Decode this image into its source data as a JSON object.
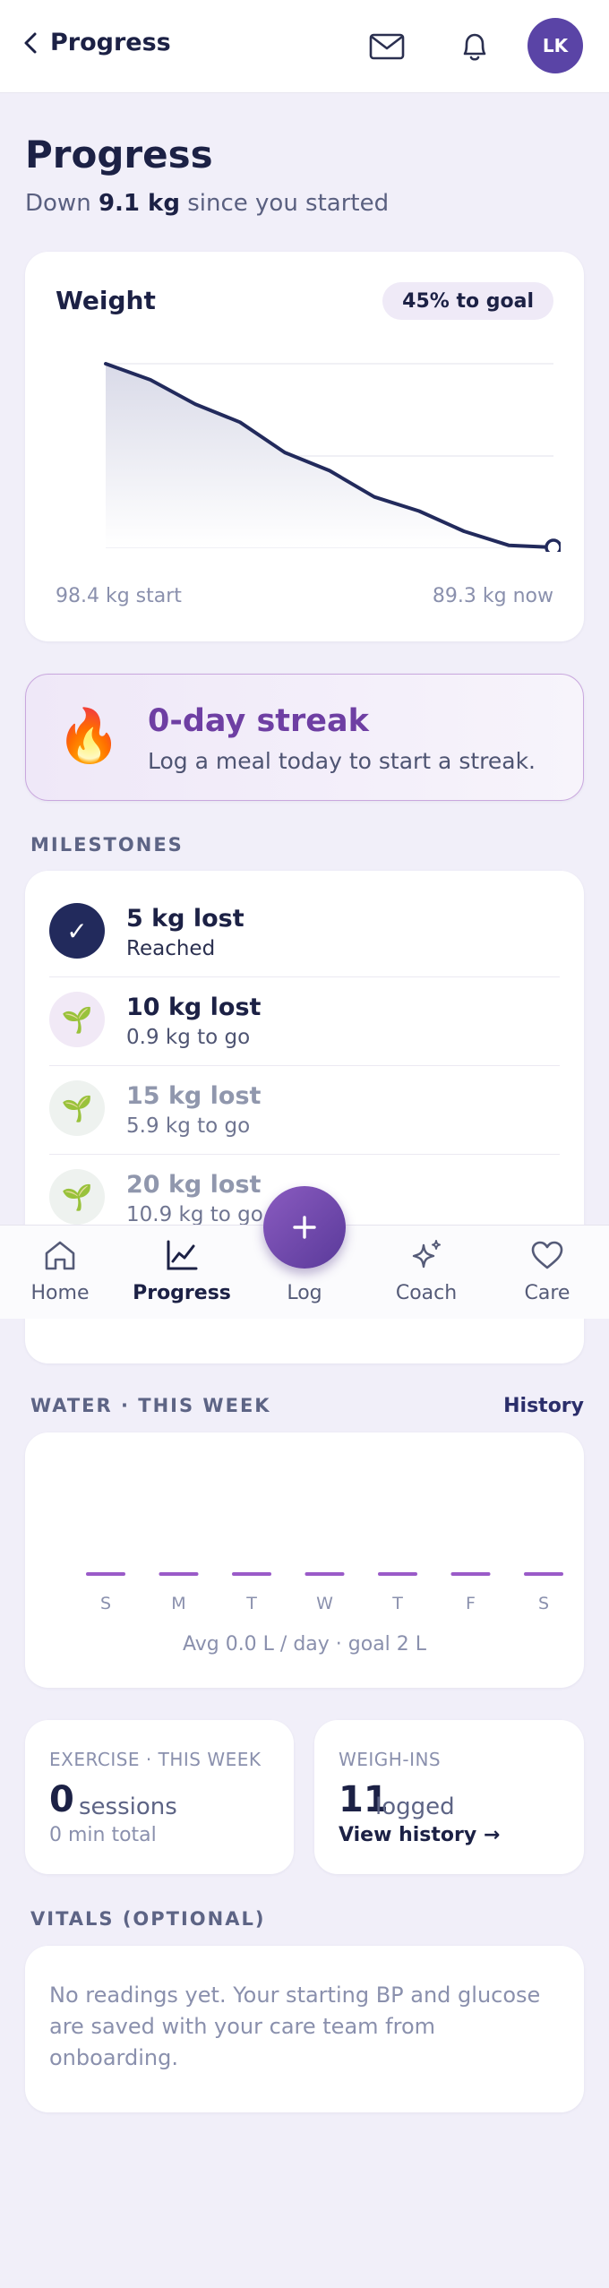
{
  "header": {
    "back_label": "Progress",
    "avatar_initials": "LK"
  },
  "page": {
    "title": "Progress",
    "subtitle_prefix": "Down ",
    "subtitle_value": "9.1 kg",
    "subtitle_suffix": " since you started"
  },
  "weight": {
    "title": "Weight",
    "goal_badge": "45% to goal",
    "start_label": "98.4 kg start",
    "now_label": "89.3 kg now"
  },
  "chart_data": [
    {
      "type": "area",
      "title": "Weight",
      "xlabel": "",
      "ylabel": "",
      "x": [
        0,
        1,
        2,
        3,
        4,
        5,
        6,
        7,
        8,
        9,
        10
      ],
      "y": [
        98.4,
        97.6,
        96.4,
        95.5,
        94.0,
        93.1,
        91.8,
        91.1,
        90.1,
        89.4,
        89.3
      ],
      "grid": true,
      "line_color": "#222a5c"
    },
    {
      "type": "bar",
      "title": "WATER · THIS WEEK",
      "categories": [
        "S",
        "M",
        "T",
        "W",
        "T",
        "F",
        "S"
      ],
      "values": [
        0,
        0,
        0,
        0,
        0,
        0,
        0
      ],
      "bar_color": "#9a5bc8"
    }
  ],
  "streak": {
    "icon": "fire-icon",
    "title": "0-day streak",
    "subtitle": "Log a meal today to start a streak."
  },
  "milestones": {
    "label": "MILESTONES",
    "items": [
      {
        "name": "5 kg lost",
        "status": "Reached",
        "icon": "check-icon"
      },
      {
        "name": "10 kg lost",
        "status": "0.9 kg to go",
        "icon": "seedling-icon"
      },
      {
        "name": "15 kg lost",
        "status": "5.9 kg to go",
        "icon": "seedling-icon"
      },
      {
        "name": "20 kg lost",
        "status": "10.9 kg to go",
        "icon": "seedling-icon"
      }
    ]
  },
  "nav": {
    "items": [
      {
        "label": "Home",
        "icon": "home-icon"
      },
      {
        "label": "Progress",
        "icon": "chart-icon"
      },
      {
        "label": "Log",
        "icon": "plus-icon"
      },
      {
        "label": "Coach",
        "icon": "sparkle-icon"
      },
      {
        "label": "Care",
        "icon": "heart-icon"
      }
    ]
  },
  "water": {
    "label": "WATER · THIS WEEK",
    "history_link": "History",
    "avg_text": "Avg 0.0 L / day · goal 2 L"
  },
  "exercise": {
    "label": "EXERCISE · THIS WEEK",
    "count": "0",
    "unit": "sessions",
    "sub": "0 min total"
  },
  "weighins": {
    "label": "WEIGH-INS",
    "count": "11",
    "unit": "logged",
    "link": "View history →"
  },
  "vitals": {
    "label": "VITALS (OPTIONAL)",
    "text": "No readings yet. Your starting BP and glucose are saved with your care team from onboarding."
  },
  "colors": {
    "accent": "#5a44a6",
    "streak_purple": "#6e3fa3",
    "navy": "#1c2145",
    "milestone_reached_bg": "#222a5c",
    "milestone_next_bg": "#f1e9f6",
    "milestone_future_bg": "#eef2ef"
  }
}
